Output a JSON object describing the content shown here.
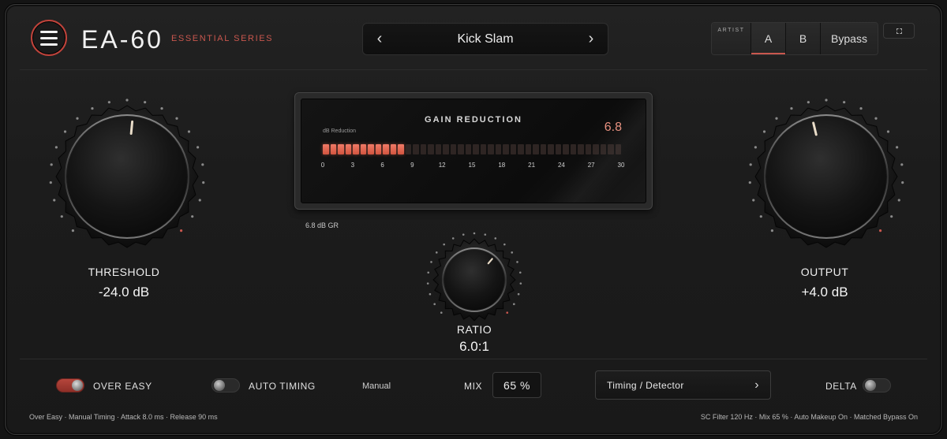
{
  "header": {
    "brand": "EA-60",
    "series": "ESSENTIAL SERIES",
    "preset_name": "Kick Slam",
    "prev_glyph": "‹",
    "next_glyph": "›",
    "artist_label": "ARTIST",
    "a_label": "A",
    "b_label": "B",
    "bypass_label": "Bypass",
    "selected_slot": "A"
  },
  "meter": {
    "title": "GAIN REDUCTION",
    "subtitle": "dB Reduction",
    "value": "6.8",
    "readout": "6.8 dB GR",
    "active_db": 6.8,
    "max_db": 30,
    "ticks": [
      "0",
      "3",
      "6",
      "9",
      "12",
      "15",
      "18",
      "21",
      "24",
      "27",
      "30"
    ]
  },
  "knobs": {
    "threshold": {
      "label": "THRESHOLD",
      "value": "-24.0 dB",
      "position": 0.52
    },
    "ratio": {
      "label": "RATIO",
      "value": "6.0:1",
      "position": 0.65
    },
    "output": {
      "label": "OUTPUT",
      "value": "+4.0 dB",
      "position": 0.45
    }
  },
  "bottom": {
    "over_easy_label": "OVER EASY",
    "over_easy_on": true,
    "auto_timing_label": "AUTO TIMING",
    "auto_timing_on": false,
    "manual_label": "Manual",
    "mix_label": "MIX",
    "mix_value": "65 %",
    "timing_label": "Timing / Detector",
    "timing_chevron": "›",
    "delta_label": "DELTA",
    "delta_on": false
  },
  "status": {
    "left": "Over Easy · Manual Timing · Attack 8.0 ms · Release 90 ms",
    "right": "SC Filter 120 Hz · Mix 65 % · Auto Makeup On · Matched Bypass On"
  },
  "colors": {
    "accent": "#c9574e",
    "meter_on": "#e8705c",
    "meter_value": "#e8907f"
  },
  "icons": {
    "menu": "hamburger-icon",
    "expand": "expand-icon"
  }
}
